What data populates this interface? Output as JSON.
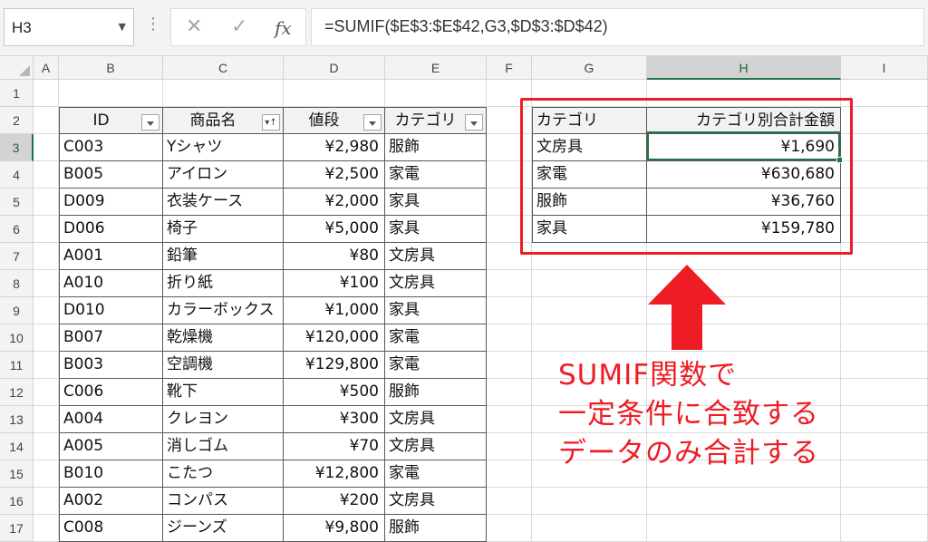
{
  "formula_bar": {
    "name_box": "H3",
    "dots": "⋮",
    "cancel_icon": "✕",
    "enter_icon": "✓",
    "fx_label": "fx",
    "formula": "=SUMIF($E$3:$E$42,G3,$D$3:$D$42)"
  },
  "columns": [
    "A",
    "B",
    "C",
    "D",
    "E",
    "F",
    "G",
    "H",
    "I"
  ],
  "rows": [
    "1",
    "2",
    "3",
    "4",
    "5",
    "6",
    "7",
    "8",
    "9",
    "10",
    "11",
    "12",
    "13",
    "14",
    "15",
    "16",
    "17"
  ],
  "table": {
    "headers": [
      "ID",
      "商品名",
      "値段",
      "カテゴリ"
    ],
    "rows": [
      [
        "C003",
        "Yシャツ",
        "¥2,980",
        "服飾"
      ],
      [
        "B005",
        "アイロン",
        "¥2,500",
        "家電"
      ],
      [
        "D009",
        "衣装ケース",
        "¥2,000",
        "家具"
      ],
      [
        "D006",
        "椅子",
        "¥5,000",
        "家具"
      ],
      [
        "A001",
        "鉛筆",
        "¥80",
        "文房具"
      ],
      [
        "A010",
        "折り紙",
        "¥100",
        "文房具"
      ],
      [
        "D010",
        "カラーボックス",
        "¥1,000",
        "家具"
      ],
      [
        "B007",
        "乾燥機",
        "¥120,000",
        "家電"
      ],
      [
        "B003",
        "空調機",
        "¥129,800",
        "家電"
      ],
      [
        "C006",
        "靴下",
        "¥500",
        "服飾"
      ],
      [
        "A004",
        "クレヨン",
        "¥300",
        "文房具"
      ],
      [
        "A005",
        "消しゴム",
        "¥70",
        "文房具"
      ],
      [
        "B010",
        "こたつ",
        "¥12,800",
        "家電"
      ],
      [
        "A002",
        "コンパス",
        "¥200",
        "文房具"
      ],
      [
        "C008",
        "ジーンズ",
        "¥9,800",
        "服飾"
      ]
    ]
  },
  "summary": {
    "headers": [
      "カテゴリ",
      "カテゴリ別合計金額"
    ],
    "rows": [
      [
        "文房具",
        "¥1,690"
      ],
      [
        "家電",
        "¥630,680"
      ],
      [
        "服飾",
        "¥36,760"
      ],
      [
        "家具",
        "¥159,780"
      ]
    ]
  },
  "annotation": {
    "lines": [
      "SUMIF関数で",
      "一定条件に合致する",
      "データのみ合計する"
    ],
    "color": "#ee1c25"
  },
  "colors": {
    "excel_green": "#217346",
    "highlight_red": "#ee1c25"
  }
}
